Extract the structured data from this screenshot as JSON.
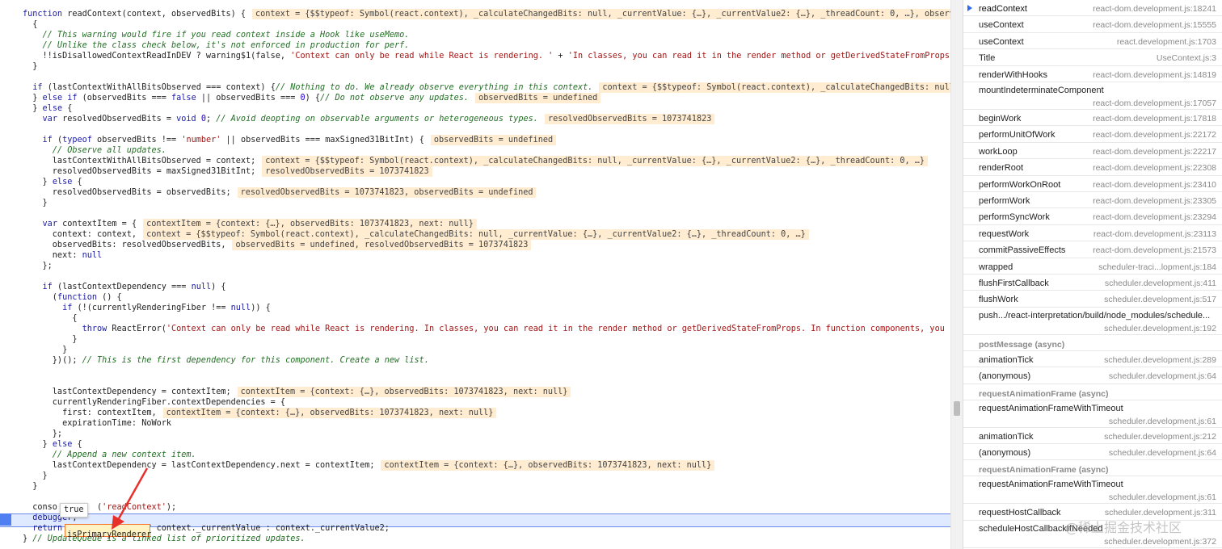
{
  "code_lines": [
    {
      "segs": [
        [
          "k",
          "function "
        ],
        [
          "t",
          "readContext(context, observedBits) {"
        ]
      ],
      "val": "context = {$$typeof: Symbol(react.context), _calculateChangedBits: null, _currentValue: {…}, _currentValue2: {…}, _threadCount: 0, …}, observ"
    },
    {
      "segs": [
        [
          "t",
          "  {"
        ]
      ]
    },
    {
      "segs": [
        [
          "c",
          "    // This warning would fire if you read context inside a Hook like useMemo."
        ]
      ]
    },
    {
      "segs": [
        [
          "c",
          "    // Unlike the class check below, it's not enforced in production for perf."
        ]
      ]
    },
    {
      "segs": [
        [
          "t",
          "    !!isDisallowedContextReadInDEV ? warning$1(false, "
        ],
        [
          "s",
          "'Context can only be read while React is rendering. '"
        ],
        [
          "t",
          " + "
        ],
        [
          "s",
          "'In classes, you can read it in the render method or getDerivedStateFromProps."
        ]
      ]
    },
    {
      "segs": [
        [
          "t",
          "  }"
        ]
      ]
    },
    {
      "segs": [
        [
          "t",
          ""
        ]
      ]
    },
    {
      "segs": [
        [
          "t",
          "  "
        ],
        [
          "k",
          "if"
        ],
        [
          "t",
          " (lastContextWithAllBitsObserved === context) {"
        ],
        [
          "c",
          "// Nothing to do. We already observe everything in this context."
        ]
      ],
      "val": "context = {$$typeof: Symbol(react.context), _calculateChangedBits: null"
    },
    {
      "segs": [
        [
          "t",
          "  } "
        ],
        [
          "k",
          "else if"
        ],
        [
          "t",
          " (observedBits === "
        ],
        [
          "k",
          "false"
        ],
        [
          "t",
          " || observedBits === "
        ],
        [
          "n",
          "0"
        ],
        [
          "t",
          ") {"
        ],
        [
          "c",
          "// Do not observe any updates."
        ]
      ],
      "val": "observedBits = undefined"
    },
    {
      "segs": [
        [
          "t",
          "  } "
        ],
        [
          "k",
          "else"
        ],
        [
          "t",
          " {"
        ]
      ]
    },
    {
      "segs": [
        [
          "t",
          "    "
        ],
        [
          "k",
          "var"
        ],
        [
          "t",
          " resolvedObservedBits = "
        ],
        [
          "k",
          "void"
        ],
        [
          "t",
          " "
        ],
        [
          "n",
          "0"
        ],
        [
          "t",
          "; "
        ],
        [
          "c",
          "// Avoid deopting on observable arguments or heterogeneous types."
        ]
      ],
      "val": "resolvedObservedBits = 1073741823"
    },
    {
      "segs": [
        [
          "t",
          ""
        ]
      ]
    },
    {
      "segs": [
        [
          "t",
          "    "
        ],
        [
          "k",
          "if"
        ],
        [
          "t",
          " ("
        ],
        [
          "k",
          "typeof"
        ],
        [
          "t",
          " observedBits !== "
        ],
        [
          "s",
          "'number'"
        ],
        [
          "t",
          " || observedBits === maxSigned31BitInt) {"
        ]
      ],
      "val": "observedBits = undefined"
    },
    {
      "segs": [
        [
          "c",
          "      // Observe all updates."
        ]
      ]
    },
    {
      "segs": [
        [
          "t",
          "      lastContextWithAllBitsObserved = context;"
        ]
      ],
      "val": "context = {$$typeof: Symbol(react.context), _calculateChangedBits: null, _currentValue: {…}, _currentValue2: {…}, _threadCount: 0, …}"
    },
    {
      "segs": [
        [
          "t",
          "      resolvedObservedBits = maxSigned31BitInt;"
        ]
      ],
      "val": "resolvedObservedBits = 1073741823"
    },
    {
      "segs": [
        [
          "t",
          "    } "
        ],
        [
          "k",
          "else"
        ],
        [
          "t",
          " {"
        ]
      ]
    },
    {
      "segs": [
        [
          "t",
          "      resolvedObservedBits = observedBits;"
        ]
      ],
      "val": "resolvedObservedBits = 1073741823, observedBits = undefined"
    },
    {
      "segs": [
        [
          "t",
          "    }"
        ]
      ]
    },
    {
      "segs": [
        [
          "t",
          ""
        ]
      ]
    },
    {
      "segs": [
        [
          "t",
          "    "
        ],
        [
          "k",
          "var"
        ],
        [
          "t",
          " contextItem = {"
        ]
      ],
      "val": "contextItem = {context: {…}, observedBits: 1073741823, next: null}"
    },
    {
      "segs": [
        [
          "t",
          "      context: context,"
        ]
      ],
      "val": "context = {$$typeof: Symbol(react.context), _calculateChangedBits: null, _currentValue: {…}, _currentValue2: {…}, _threadCount: 0, …}"
    },
    {
      "segs": [
        [
          "t",
          "      observedBits: resolvedObservedBits,"
        ]
      ],
      "val": "observedBits = undefined, resolvedObservedBits = 1073741823"
    },
    {
      "segs": [
        [
          "t",
          "      next: "
        ],
        [
          "k",
          "null"
        ]
      ]
    },
    {
      "segs": [
        [
          "t",
          "    };"
        ]
      ]
    },
    {
      "segs": [
        [
          "t",
          ""
        ]
      ]
    },
    {
      "segs": [
        [
          "t",
          "    "
        ],
        [
          "k",
          "if"
        ],
        [
          "t",
          " (lastContextDependency === "
        ],
        [
          "k",
          "null"
        ],
        [
          "t",
          ") {"
        ]
      ]
    },
    {
      "segs": [
        [
          "t",
          "      ("
        ],
        [
          "k",
          "function"
        ],
        [
          "t",
          " () {"
        ]
      ]
    },
    {
      "segs": [
        [
          "t",
          "        "
        ],
        [
          "k",
          "if"
        ],
        [
          "t",
          " (!(currentlyRenderingFiber !== "
        ],
        [
          "k",
          "null"
        ],
        [
          "t",
          ")) {"
        ]
      ]
    },
    {
      "segs": [
        [
          "t",
          "          {"
        ]
      ]
    },
    {
      "segs": [
        [
          "t",
          "            "
        ],
        [
          "k",
          "throw"
        ],
        [
          "t",
          " ReactError("
        ],
        [
          "s",
          "'Context can only be read while React is rendering. In classes, you can read it in the render method or getDerivedStateFromProps. In function components, you c"
        ]
      ]
    },
    {
      "segs": [
        [
          "t",
          "          }"
        ]
      ]
    },
    {
      "segs": [
        [
          "t",
          "        }"
        ]
      ]
    },
    {
      "segs": [
        [
          "t",
          "      })(); "
        ],
        [
          "c",
          "// This is the first dependency for this component. Create a new list."
        ]
      ]
    },
    {
      "segs": [
        [
          "t",
          ""
        ]
      ]
    },
    {
      "segs": [
        [
          "t",
          ""
        ]
      ]
    },
    {
      "segs": [
        [
          "t",
          "      lastContextDependency = contextItem;"
        ]
      ],
      "val": "contextItem = {context: {…}, observedBits: 1073741823, next: null}"
    },
    {
      "segs": [
        [
          "t",
          "      currentlyRenderingFiber.contextDependencies = {"
        ]
      ]
    },
    {
      "segs": [
        [
          "t",
          "        first: contextItem,"
        ]
      ],
      "val": "contextItem = {context: {…}, observedBits: 1073741823, next: null}"
    },
    {
      "segs": [
        [
          "t",
          "        expirationTime: NoWork"
        ]
      ]
    },
    {
      "segs": [
        [
          "t",
          "      };"
        ]
      ]
    },
    {
      "segs": [
        [
          "t",
          "    } "
        ],
        [
          "k",
          "else"
        ],
        [
          "t",
          " {"
        ]
      ]
    },
    {
      "segs": [
        [
          "c",
          "      // Append a new context item."
        ]
      ]
    },
    {
      "segs": [
        [
          "t",
          "      lastContextDependency = lastContextDependency.next = contextItem;"
        ]
      ],
      "val": "contextItem = {context: {…}, observedBits: 1073741823, next: null}"
    },
    {
      "segs": [
        [
          "t",
          "    }"
        ]
      ]
    },
    {
      "segs": [
        [
          "t",
          "  }"
        ]
      ]
    },
    {
      "segs": [
        [
          "t",
          ""
        ]
      ]
    },
    {
      "segs": [
        [
          "t",
          "  conso        ("
        ],
        [
          "s",
          "'readContext'"
        ],
        [
          "t",
          ");"
        ]
      ]
    },
    {
      "segs": [
        [
          "k",
          "  debugger"
        ],
        [
          "t",
          ";"
        ]
      ]
    },
    {
      "segs": [
        [
          "t",
          "  "
        ],
        [
          "k",
          "return"
        ],
        [
          "t",
          "                 ? context._currentValue : context._currentValue2;"
        ]
      ]
    },
    {
      "segs": [
        [
          "t",
          "} "
        ],
        [
          "c",
          "// UpdateQueue is a linked list of prioritized updates."
        ]
      ]
    }
  ],
  "tooltip_value": "true",
  "hovered_expression": "isPrimaryRenderer",
  "call_stack": [
    {
      "fn": "readContext",
      "loc": "react-dom.development.js:18241",
      "current": true
    },
    {
      "fn": "useContext",
      "loc": "react-dom.development.js:15555"
    },
    {
      "fn": "useContext",
      "loc": "react.development.js:1703"
    },
    {
      "fn": "Title",
      "loc": "UseContext.js:3"
    },
    {
      "fn": "renderWithHooks",
      "loc": "react-dom.development.js:14819"
    },
    {
      "fn": "mountIndeterminateComponent",
      "loc": "react-dom.development.js:17057",
      "two": true
    },
    {
      "fn": "beginWork",
      "loc": "react-dom.development.js:17818"
    },
    {
      "fn": "performUnitOfWork",
      "loc": "react-dom.development.js:22172"
    },
    {
      "fn": "workLoop",
      "loc": "react-dom.development.js:22217"
    },
    {
      "fn": "renderRoot",
      "loc": "react-dom.development.js:22308"
    },
    {
      "fn": "performWorkOnRoot",
      "loc": "react-dom.development.js:23410"
    },
    {
      "fn": "performWork",
      "loc": "react-dom.development.js:23305"
    },
    {
      "fn": "performSyncWork",
      "loc": "react-dom.development.js:23294"
    },
    {
      "fn": "requestWork",
      "loc": "react-dom.development.js:23113"
    },
    {
      "fn": "commitPassiveEffects",
      "loc": "react-dom.development.js:21573"
    },
    {
      "fn": "wrapped",
      "loc": "scheduler-traci...lopment.js:184"
    },
    {
      "fn": "flushFirstCallback",
      "loc": "scheduler.development.js:411"
    },
    {
      "fn": "flushWork",
      "loc": "scheduler.development.js:517"
    },
    {
      "fn": "push.../react-interpretation/build/node_modules/schedule...",
      "loc": "scheduler.development.js:192",
      "two": true
    },
    {
      "async": "postMessage (async)"
    },
    {
      "fn": "animationTick",
      "loc": "scheduler.development.js:289"
    },
    {
      "fn": "(anonymous)",
      "loc": "scheduler.development.js:64"
    },
    {
      "async": "requestAnimationFrame (async)"
    },
    {
      "fn": "requestAnimationFrameWithTimeout",
      "loc": "scheduler.development.js:61",
      "two": true
    },
    {
      "fn": "animationTick",
      "loc": "scheduler.development.js:212"
    },
    {
      "fn": "(anonymous)",
      "loc": "scheduler.development.js:64"
    },
    {
      "async": "requestAnimationFrame (async)"
    },
    {
      "fn": "requestAnimationFrameWithTimeout",
      "loc": "scheduler.development.js:61",
      "two": true
    },
    {
      "fn": "requestHostCallback",
      "loc": "scheduler.development.js:311"
    },
    {
      "fn": "scheduleHostCallbackIfNeeded",
      "loc": "scheduler.development.js:372",
      "two": true
    }
  ],
  "watermark": "@稀土掘金技术社区",
  "colors": {
    "paused_line": "#dfe9ff",
    "inline_value_bg": "#ffecd1",
    "arrow": "#e8302a",
    "current_frame_marker": "#2a6bf2"
  }
}
